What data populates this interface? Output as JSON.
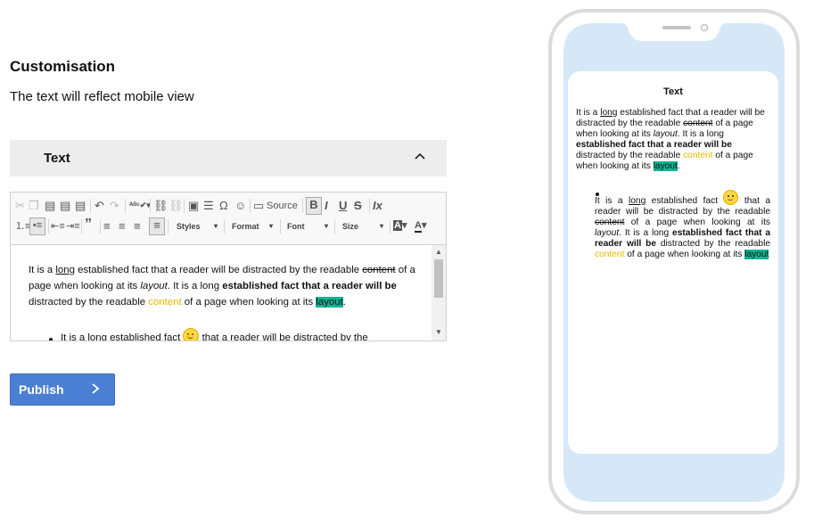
{
  "page": {
    "title": "Customisation",
    "subtitle": "The text will reflect mobile view"
  },
  "accordion": {
    "label": "Text",
    "expanded": true
  },
  "editor": {
    "toolbar": {
      "source_label": "Source",
      "styles_label": "Styles",
      "format_label": "Format",
      "font_label": "Font",
      "size_label": "Size"
    },
    "content": {
      "p_it_is_a": "It is a ",
      "p_long": "long",
      "p_established": " established fact that a reader will be distracted by the readable ",
      "p_content": "content",
      "p_of_a_page": " of a page when looking at its ",
      "p_layout_italic": "layout",
      "p_it_is_long": ". It is a long ",
      "p_bold": "established fact that a reader will be",
      "p_distracted": " distracted by the readable ",
      "p_content_yellow": "content",
      "p_of_a_page2": " of a page when looking at its ",
      "p_layout_hl": "layout",
      "p_end": ".",
      "bullet_start": "It is a long established fact ",
      "bullet_end": " that a reader will be distracted by the"
    }
  },
  "publish": {
    "label": "Publish"
  },
  "mobile_preview": {
    "title": "Text",
    "p_it_is_a": "It is a ",
    "p_long": "long",
    "p_established": " established fact that a reader will be distracted by the readable ",
    "p_content": "content",
    "p_of_a_page": " of a page when looking at its ",
    "p_layout_italic": "layout",
    "p_it_is_long": ". It is a long ",
    "p_bold": "established fact that a reader will be",
    "p_distracted": " distracted by the readable ",
    "p_content_yellow": "content",
    "p_of_a_page2": " of a page when looking at its ",
    "p_layout_hl": "layout",
    "p_end": ".",
    "b_it_is_a": "It is a ",
    "b_long": "long",
    "b_established": " established fact ",
    "b_that": " that a reader will be distracted by the readable ",
    "b_content": "content",
    "b_of_a_page": " of a page when looking at its ",
    "b_layout_italic": "layout",
    "b_it_is_long": ". It is a long ",
    "b_bold": "established fact that a reader will be",
    "b_distracted": " distracted by the readable ",
    "b_content_yellow": "content",
    "b_of_a_page2": " of a page when looking at its ",
    "b_layout_hl": "layout"
  },
  "colors": {
    "accent_blue": "#4a7fd4",
    "highlight_teal": "#12b493",
    "text_yellow": "#e5b800",
    "phone_screen": "#d6e8f8",
    "phone_frame": "#dcdcdc"
  },
  "icons": [
    "cut-icon",
    "copy-icon",
    "paste-icon",
    "paste-text-icon",
    "paste-word-icon",
    "undo-icon",
    "redo-icon",
    "spellcheck-icon",
    "link-icon",
    "unlink-icon",
    "image-icon",
    "horizontal-line-icon",
    "special-char-icon",
    "smiley-icon",
    "source-icon",
    "bold-icon",
    "italic-icon",
    "underline-icon",
    "strike-icon",
    "remove-format-icon",
    "numbered-list-icon",
    "bulleted-list-icon",
    "outdent-icon",
    "indent-icon",
    "blockquote-icon",
    "align-left-icon",
    "align-center-icon",
    "align-right-icon",
    "justify-icon",
    "bg-color-icon",
    "text-color-icon",
    "chevron-up-icon",
    "chevron-right-icon"
  ]
}
